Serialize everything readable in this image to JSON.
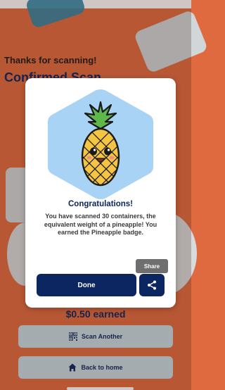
{
  "background_page": {
    "subtitle": "Thanks for scanning!",
    "title": "Confirmed Scan",
    "earned": "$0.50 earned",
    "scan_another_label": "Scan Another",
    "back_home_label": "Back to home"
  },
  "modal": {
    "badge_icon": "pineapple-badge-icon",
    "title": "Congratulations!",
    "body": "You have scanned 30 containers, the equivalent weight of a pineapple! You earned the Pineapple badge.",
    "done_label": "Done",
    "share_icon": "share-icon"
  },
  "tooltip": {
    "label": "Share"
  },
  "colors": {
    "background": "#e06a3f",
    "primary": "#0b2660",
    "badge_hex": "#a9d3f5",
    "button_bg": "#c9dbe4"
  }
}
